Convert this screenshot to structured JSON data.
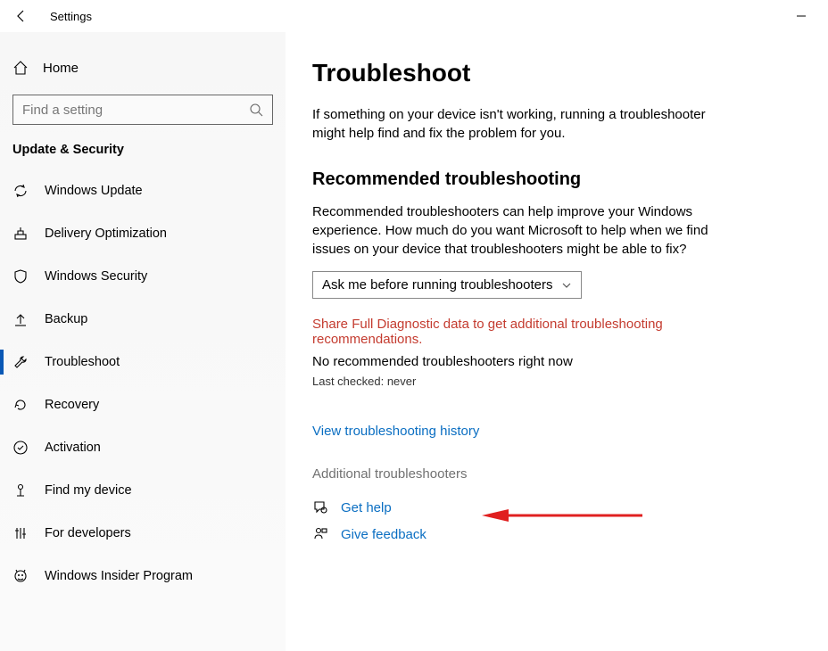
{
  "window": {
    "title": "Settings"
  },
  "sidebar": {
    "home": "Home",
    "search_placeholder": "Find a setting",
    "section": "Update & Security",
    "items": [
      {
        "label": "Windows Update"
      },
      {
        "label": "Delivery Optimization"
      },
      {
        "label": "Windows Security"
      },
      {
        "label": "Backup"
      },
      {
        "label": "Troubleshoot"
      },
      {
        "label": "Recovery"
      },
      {
        "label": "Activation"
      },
      {
        "label": "Find my device"
      },
      {
        "label": "For developers"
      },
      {
        "label": "Windows Insider Program"
      }
    ]
  },
  "main": {
    "title": "Troubleshoot",
    "intro": "If something on your device isn't working, running a troubleshooter might help find and fix the problem for you.",
    "rec_title": "Recommended troubleshooting",
    "rec_body": "Recommended troubleshooters can help improve your Windows experience. How much do you want Microsoft to help when we find issues on your device that troubleshooters might be able to fix?",
    "select_value": "Ask me before running troubleshooters",
    "diag_warning": "Share Full Diagnostic data to get additional troubleshooting recommendations.",
    "no_rec": "No recommended troubleshooters right now",
    "last_checked": "Last checked: never",
    "view_history": "View troubleshooting history",
    "additional": "Additional troubleshooters",
    "get_help": "Get help",
    "give_feedback": "Give feedback"
  }
}
